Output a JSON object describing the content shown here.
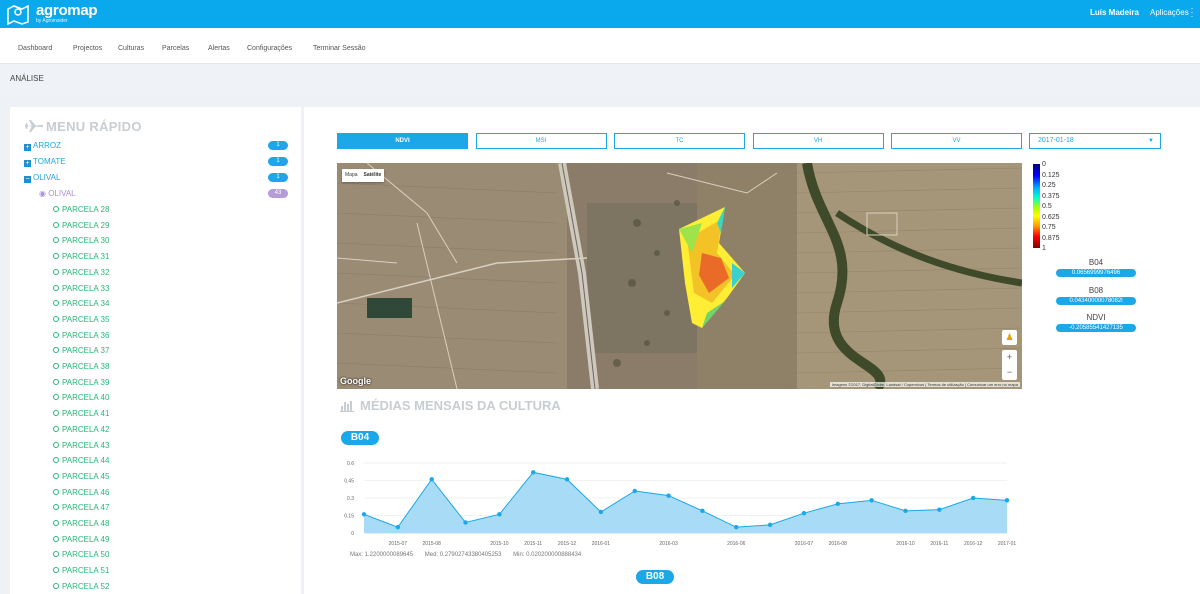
{
  "brand": {
    "name": "agromap",
    "sub": "by Agroinsider"
  },
  "header": {
    "user": "Luís Madeira",
    "apps": "Aplicações"
  },
  "nav": [
    "Dashboard",
    "Projectos",
    "Culturas",
    "Parcelas",
    "Alertas",
    "Configurações",
    "Terminar Sessão"
  ],
  "page": {
    "title": "ANÁLISE"
  },
  "sidebar": {
    "title": "MENU RÁPIDO",
    "crops": [
      {
        "label": "ARROZ",
        "count": "1",
        "expanded": false
      },
      {
        "label": "TOMATE",
        "count": "1",
        "expanded": false
      },
      {
        "label": "OLIVAL",
        "count": "1",
        "expanded": true
      }
    ],
    "sub_crop": {
      "label": "OLIVAL",
      "count": "43"
    },
    "parcels": [
      "PARCELA 28",
      "PARCELA 29",
      "PARCELA 30",
      "PARCELA 31",
      "PARCELA 32",
      "PARCELA 33",
      "PARCELA 34",
      "PARCELA 35",
      "PARCELA 36",
      "PARCELA 37",
      "PARCELA 38",
      "PARCELA 39",
      "PARCELA 40",
      "PARCELA 41",
      "PARCELA 42",
      "PARCELA 43",
      "PARCELA 44",
      "PARCELA 45",
      "PARCELA 46",
      "PARCELA 47",
      "PARCELA 48",
      "PARCELA 49",
      "PARCELA 50",
      "PARCELA 51",
      "PARCELA 52"
    ]
  },
  "tabs": [
    "NDVI",
    "MSI",
    "TC",
    "VH",
    "VV"
  ],
  "active_tab": "NDVI",
  "date_select": "2017-01-18",
  "map": {
    "type_options": [
      "Mapa",
      "Satélite"
    ],
    "selected_type": "Satélite",
    "google": "Google",
    "attribution": "Imagens ©2017, DigitalGlobe, Landsat / Copernicus | Termos de utilização | Comunicar um erro no mapa"
  },
  "legend": [
    "0",
    "0.125",
    "0.25",
    "0.375",
    "0.5",
    "0.625",
    "0.75",
    "0.875",
    "1"
  ],
  "values": [
    {
      "label": "B04",
      "value": "0.0656999976496"
    },
    {
      "label": "B08",
      "value": "0.04340000078082l"
    },
    {
      "label": "NDVI",
      "value": "-0.20585541427135"
    }
  ],
  "section_title": "MÉDIAS MENSAIS DA CULTURA",
  "pill_b04": "B04",
  "pill_b08": "B08",
  "chart_stats": {
    "max": "Max: 1.2200000089645",
    "med": "Med: 0.27902743380405253",
    "min": "Min: 0.020200000888434"
  },
  "chart_data": {
    "type": "area",
    "yticks": [
      "0",
      "0.15",
      "0.3",
      "0.45",
      "0.6"
    ],
    "ylim": [
      0,
      0.6
    ],
    "xticks": [
      "2015-07",
      "2015-08",
      "2015-10",
      "2015-11",
      "2015-12",
      "2016-01",
      "2016-03",
      "2016-06",
      "2016-07",
      "2016-08",
      "2016-10",
      "2016-11",
      "2016-12",
      "2017-01"
    ],
    "series": [
      {
        "name": "B04",
        "values": [
          0.16,
          0.05,
          0.46,
          0.09,
          0.16,
          0.52,
          0.46,
          0.18,
          0.36,
          0.32,
          0.19,
          0.05,
          0.07,
          0.17,
          0.25,
          0.28,
          0.19,
          0.2,
          0.3,
          0.28
        ]
      }
    ],
    "color": "#1ba7e8"
  }
}
